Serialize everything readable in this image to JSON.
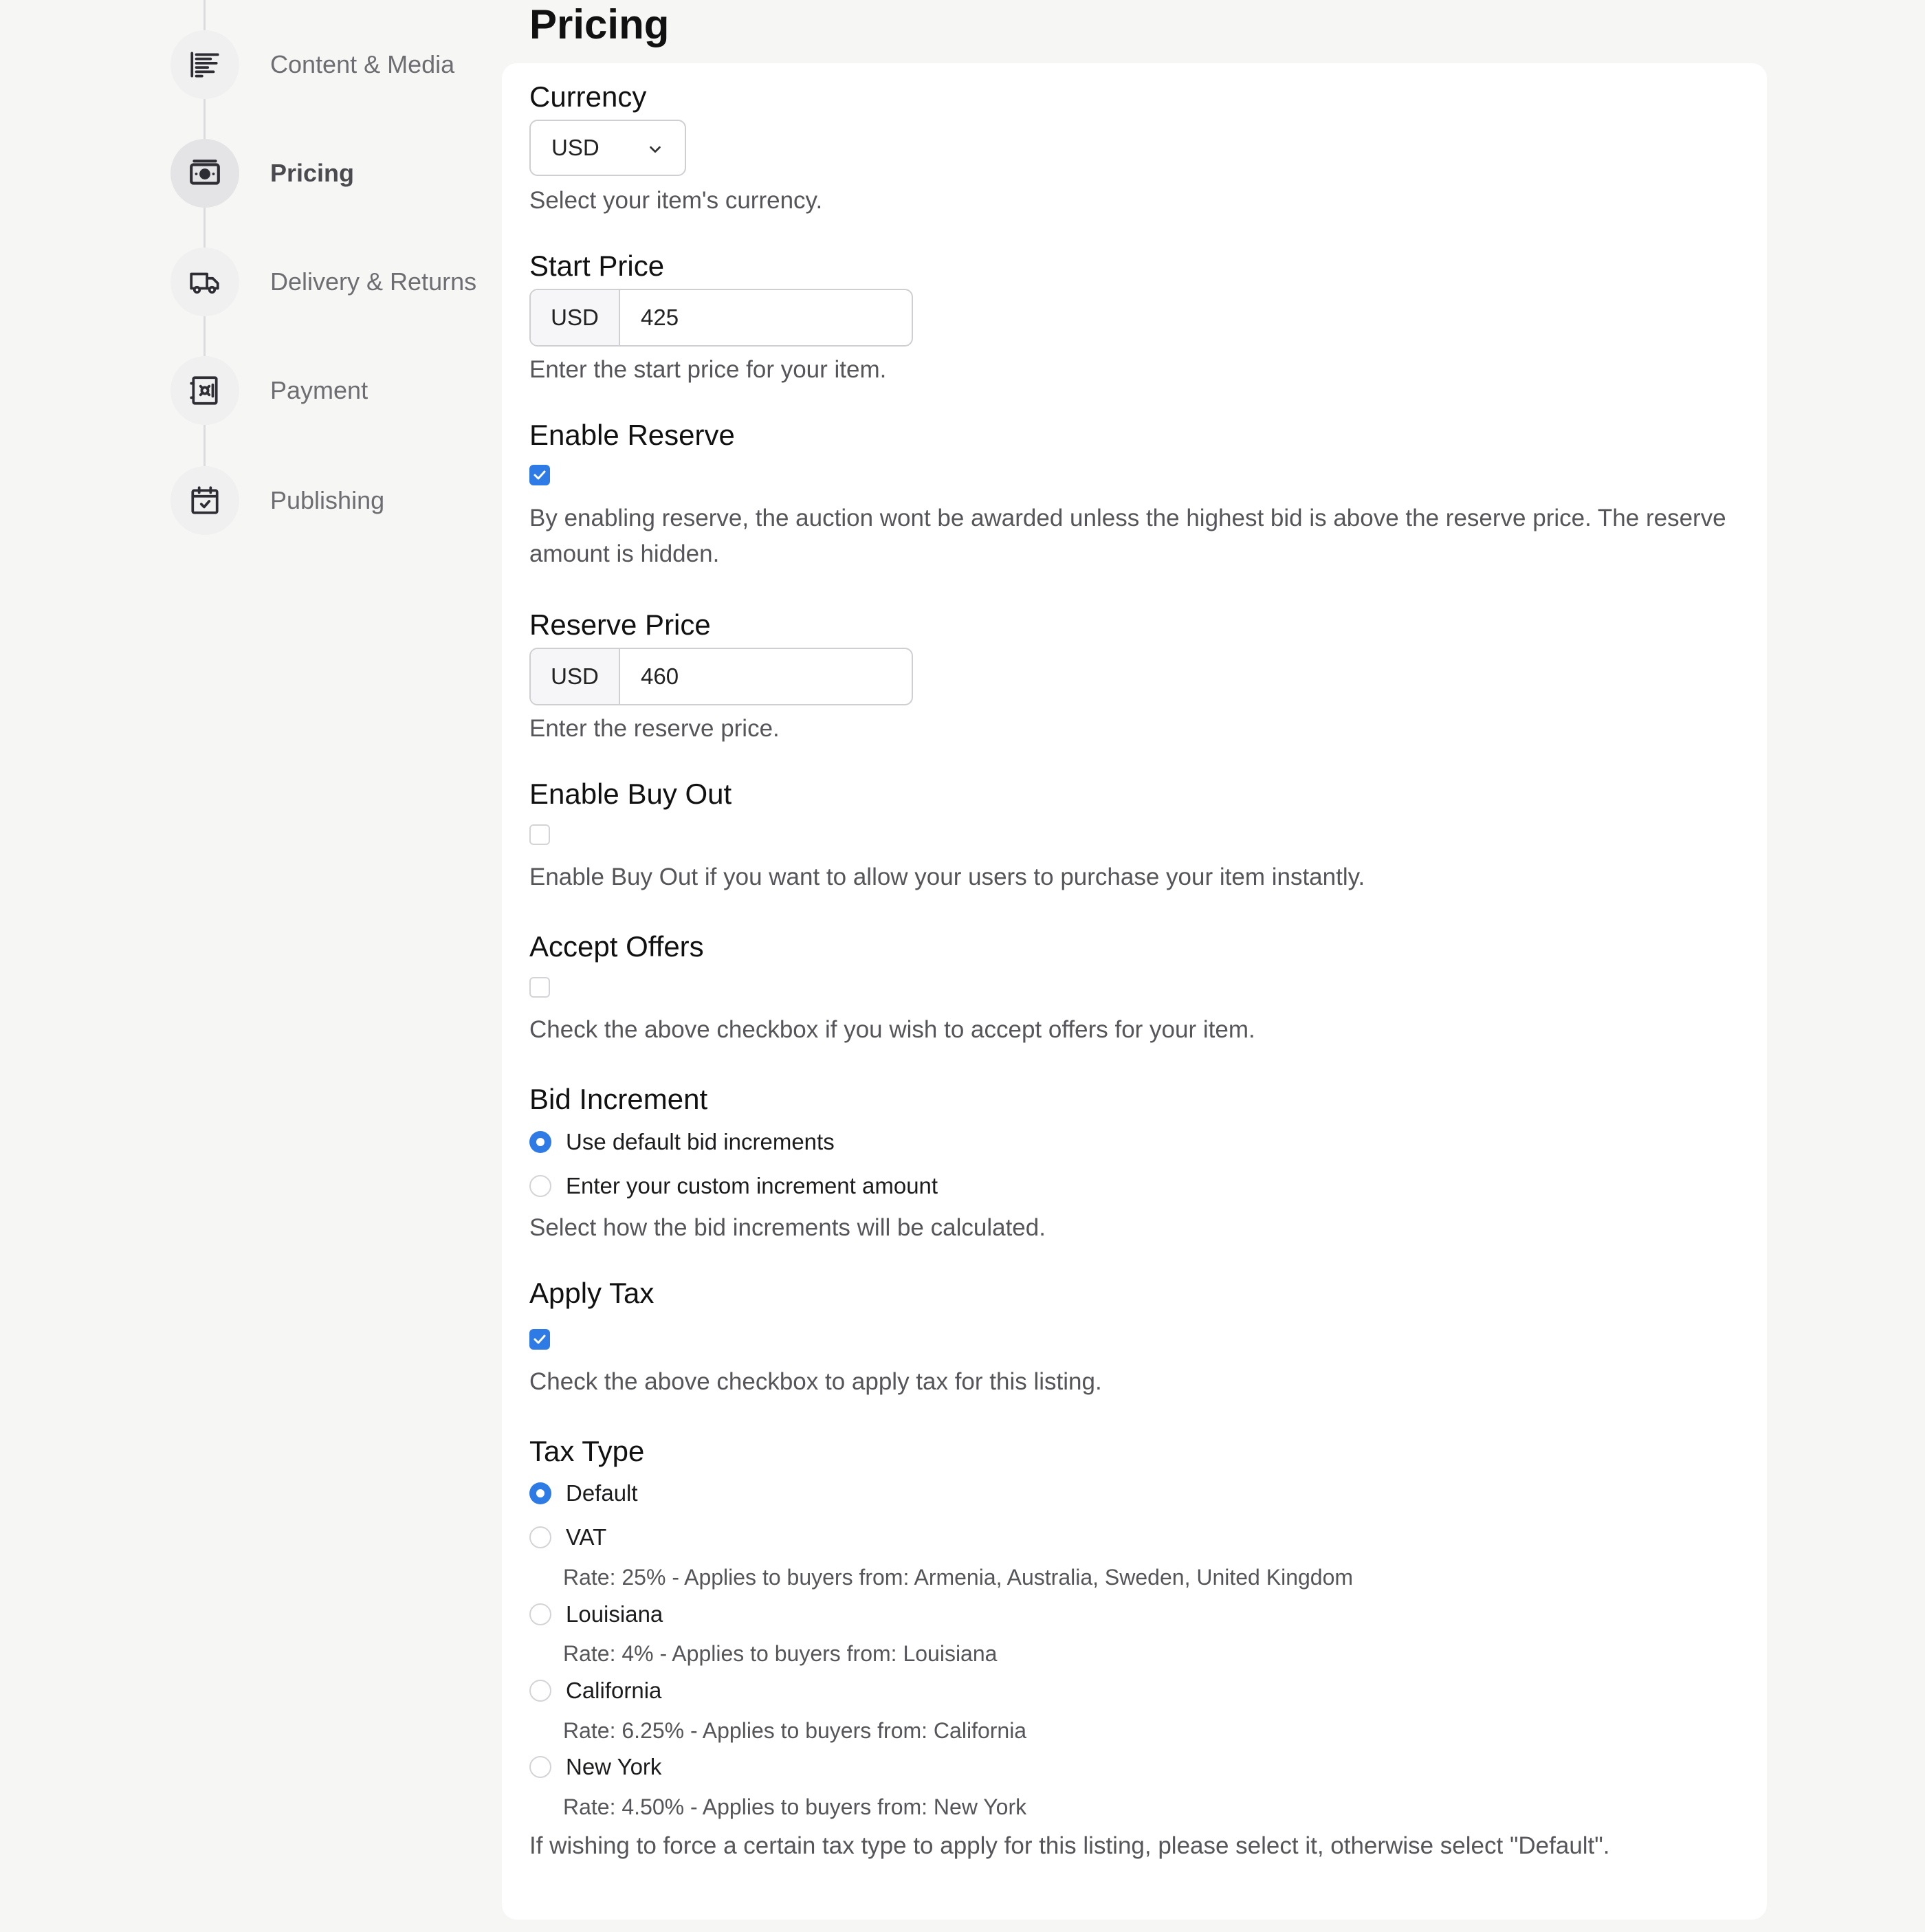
{
  "sidebar": {
    "steps": [
      {
        "label": "Content & Media",
        "icon": "content-media-icon"
      },
      {
        "label": "Pricing",
        "icon": "banknote-icon",
        "active": true
      },
      {
        "label": "Delivery & Returns",
        "icon": "truck-icon"
      },
      {
        "label": "Payment",
        "icon": "safe-icon"
      },
      {
        "label": "Publishing",
        "icon": "calendar-check-icon"
      }
    ]
  },
  "page": {
    "title": "Pricing"
  },
  "accent_color": "#2f7be6",
  "form": {
    "currency": {
      "label": "Currency",
      "value": "USD",
      "help": "Select your item's currency."
    },
    "start_price": {
      "label": "Start Price",
      "addon": "USD",
      "value": "425",
      "help": "Enter the start price for your item."
    },
    "enable_reserve": {
      "label": "Enable Reserve",
      "checked": true,
      "help": "By enabling reserve, the auction wont be awarded unless the highest bid is above the reserve price. The reserve amount is hidden."
    },
    "reserve_price": {
      "label": "Reserve Price",
      "addon": "USD",
      "value": "460",
      "help": "Enter the reserve price."
    },
    "enable_buy_out": {
      "label": "Enable Buy Out",
      "checked": false,
      "help": "Enable Buy Out if you want to allow your users to purchase your item instantly."
    },
    "accept_offers": {
      "label": "Accept Offers",
      "checked": false,
      "help": "Check the above checkbox if you wish to accept offers for your item."
    },
    "bid_increment": {
      "label": "Bid Increment",
      "options": [
        {
          "label": "Use default bid increments",
          "selected": true
        },
        {
          "label": "Enter your custom increment amount",
          "selected": false
        }
      ],
      "help": "Select how the bid increments will be calculated."
    },
    "apply_tax": {
      "label": "Apply Tax",
      "checked": true,
      "help": "Check the above checkbox to apply tax for this listing."
    },
    "tax_type": {
      "label": "Tax Type",
      "options": [
        {
          "label": "Default",
          "selected": true,
          "rate": ""
        },
        {
          "label": "VAT",
          "selected": false,
          "rate": "Rate: 25% - Applies to buyers from: Armenia, Australia, Sweden, United Kingdom"
        },
        {
          "label": "Louisiana",
          "selected": false,
          "rate": "Rate: 4% - Applies to buyers from: Louisiana"
        },
        {
          "label": "California",
          "selected": false,
          "rate": "Rate: 6.25% - Applies to buyers from: California"
        },
        {
          "label": "New York",
          "selected": false,
          "rate": "Rate: 4.50% - Applies to buyers from: New York"
        }
      ],
      "help": "If wishing to force a certain tax type to apply for this listing, please select it, otherwise select \"Default\"."
    }
  }
}
